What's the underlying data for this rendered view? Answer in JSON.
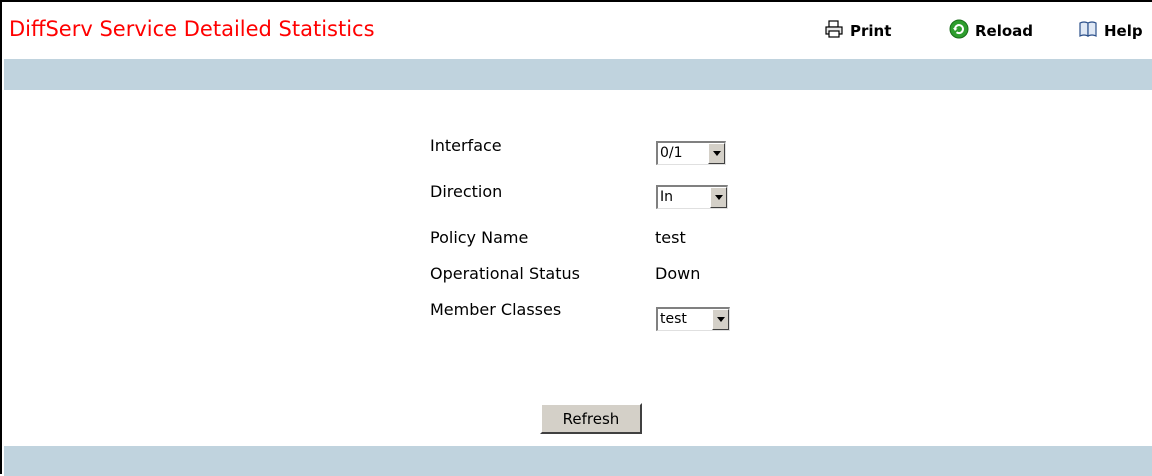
{
  "page": {
    "title": "DiffServ Service Detailed Statistics"
  },
  "toolbar": {
    "print_label": "Print",
    "reload_label": "Reload",
    "help_label": "Help"
  },
  "form": {
    "interface": {
      "label": "Interface",
      "value": "0/1"
    },
    "direction": {
      "label": "Direction",
      "value": "In"
    },
    "policy_name": {
      "label": "Policy Name",
      "value": "test"
    },
    "operational_status": {
      "label": "Operational Status",
      "value": "Down"
    },
    "member_classes": {
      "label": "Member Classes",
      "value": "test"
    }
  },
  "buttons": {
    "refresh_label": "Refresh"
  },
  "colors": {
    "title": "#ff0000",
    "band": "#c0d3de",
    "reload_icon": "#2e9e2e"
  }
}
